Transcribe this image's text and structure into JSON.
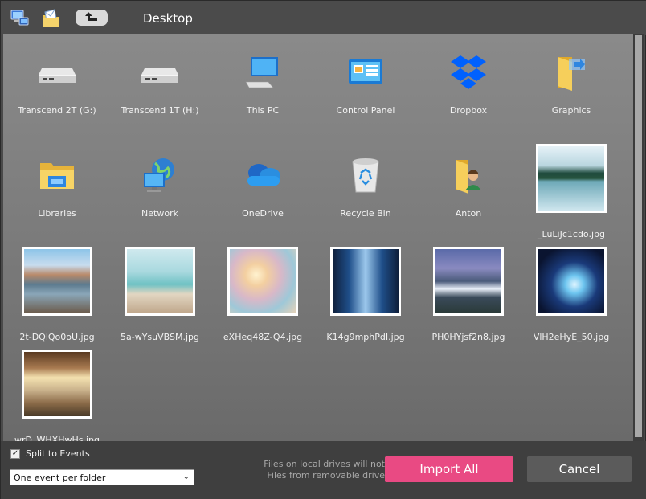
{
  "header": {
    "title": "Desktop",
    "icons": [
      "computer-icon",
      "envelope-folder-icon",
      "up-arrow-icon"
    ]
  },
  "items": [
    {
      "label": "Transcend 2T (G:)",
      "icon": "drive-icon"
    },
    {
      "label": "Transcend 1T (H:)",
      "icon": "drive-icon"
    },
    {
      "label": "This PC",
      "icon": "computer-icon"
    },
    {
      "label": "Control Panel",
      "icon": "control-panel-icon"
    },
    {
      "label": "Dropbox",
      "icon": "dropbox-icon"
    },
    {
      "label": "Graphics",
      "icon": "folder-icon"
    },
    {
      "label": "Libraries",
      "icon": "libraries-icon"
    },
    {
      "label": "Network",
      "icon": "network-icon"
    },
    {
      "label": "OneDrive",
      "icon": "cloud-icon"
    },
    {
      "label": "Recycle Bin",
      "icon": "recycle-bin-icon"
    },
    {
      "label": "Anton",
      "icon": "user-folder-icon"
    },
    {
      "label": "_LuLiJc1cdo.jpg",
      "icon": "photo"
    },
    {
      "label": "2t-DQlQo0oU.jpg",
      "icon": "photo"
    },
    {
      "label": "5a-wYsuVBSM.jpg",
      "icon": "photo"
    },
    {
      "label": "eXHeq48Z-Q4.jpg",
      "icon": "photo"
    },
    {
      "label": "K14g9mphPdI.jpg",
      "icon": "photo"
    },
    {
      "label": "PH0HYjsf2n8.jpg",
      "icon": "photo"
    },
    {
      "label": "VlH2eHyE_50.jpg",
      "icon": "photo"
    },
    {
      "label": "wrD_WHXHwHs.jpg",
      "icon": "photo"
    }
  ],
  "footer": {
    "split_label": "Split to Events",
    "split_checked": true,
    "event_select": "One event per folder",
    "note_line1": "Files on local drives will not",
    "note_line2": "Files from removable drive",
    "import_label": "Import All",
    "cancel_label": "Cancel"
  },
  "colors": {
    "accent": "#e94a83",
    "background": "#4a4a4a"
  }
}
